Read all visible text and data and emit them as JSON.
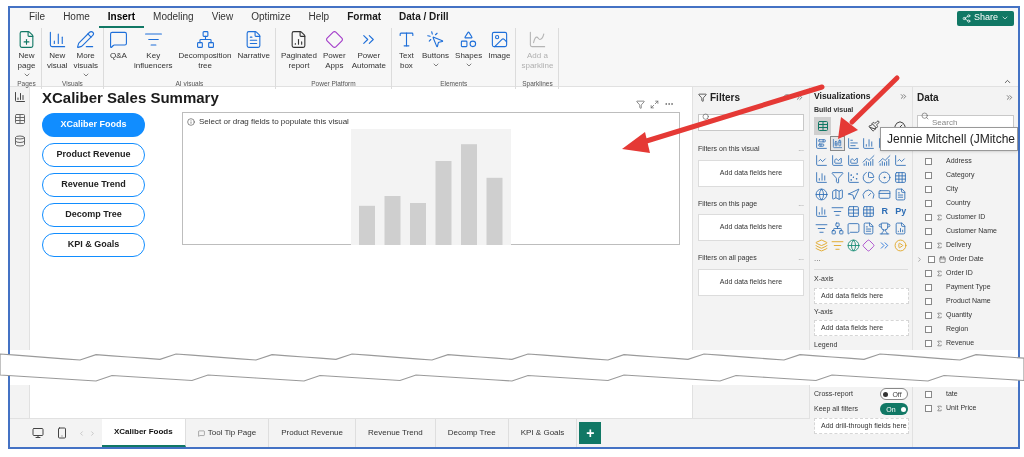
{
  "ribbon": {
    "tabs": [
      {
        "label": "File",
        "selected": false,
        "contextual": false
      },
      {
        "label": "Home",
        "selected": false,
        "contextual": false
      },
      {
        "label": "Insert",
        "selected": true,
        "contextual": false
      },
      {
        "label": "Modeling",
        "selected": false,
        "contextual": false
      },
      {
        "label": "View",
        "selected": false,
        "contextual": false
      },
      {
        "label": "Optimize",
        "selected": false,
        "contextual": false
      },
      {
        "label": "Help",
        "selected": false,
        "contextual": false
      },
      {
        "label": "Format",
        "selected": false,
        "contextual": true
      },
      {
        "label": "Data / Drill",
        "selected": false,
        "contextual": true
      }
    ],
    "share": "Share",
    "groups": [
      {
        "label": "Pages",
        "buttons": [
          {
            "label": "New\npage",
            "dropdown": true,
            "disabled": false
          }
        ]
      },
      {
        "label": "Visuals",
        "buttons": [
          {
            "label": "New\nvisual",
            "dropdown": false,
            "disabled": false
          },
          {
            "label": "More\nvisuals",
            "dropdown": true,
            "disabled": false
          }
        ]
      },
      {
        "label": "AI visuals",
        "buttons": [
          {
            "label": "Q&A",
            "dropdown": false,
            "disabled": false
          },
          {
            "label": "Key\ninfluencers",
            "dropdown": false,
            "disabled": false
          },
          {
            "label": "Decomposition\ntree",
            "dropdown": false,
            "disabled": false
          },
          {
            "label": "Narrative",
            "dropdown": false,
            "disabled": false
          }
        ]
      },
      {
        "label": "Power Platform",
        "buttons": [
          {
            "label": "Paginated\nreport",
            "dropdown": false,
            "disabled": false
          },
          {
            "label": "Power\nApps",
            "dropdown": false,
            "disabled": false
          },
          {
            "label": "Power\nAutomate",
            "dropdown": false,
            "disabled": false
          }
        ]
      },
      {
        "label": "Elements",
        "buttons": [
          {
            "label": "Text\nbox",
            "dropdown": false,
            "disabled": false
          },
          {
            "label": "Buttons",
            "dropdown": true,
            "disabled": false
          },
          {
            "label": "Shapes",
            "dropdown": true,
            "disabled": false
          },
          {
            "label": "Image",
            "dropdown": false,
            "disabled": false
          }
        ]
      },
      {
        "label": "Sparklines",
        "buttons": [
          {
            "label": "Add a\nsparkline",
            "dropdown": false,
            "disabled": true
          }
        ]
      }
    ]
  },
  "canvas": {
    "title": "XCaliber Sales Summary",
    "nav_buttons": [
      {
        "label": "XCaliber Foods",
        "selected": true
      },
      {
        "label": "Product Revenue",
        "selected": false
      },
      {
        "label": "Revenue Trend",
        "selected": false
      },
      {
        "label": "Decomp Tree",
        "selected": false
      },
      {
        "label": "KPI & Goals",
        "selected": false
      }
    ],
    "visual": {
      "hint": "Select or drag fields to populate this visual"
    }
  },
  "filters": {
    "title": "Filters",
    "sections": [
      {
        "title": "Filters on this visual",
        "more": "...",
        "drop": "Add data fields here"
      },
      {
        "title": "Filters on this page",
        "more": "...",
        "drop": "Add data fields here"
      },
      {
        "title": "Filters on all pages",
        "more": "...",
        "drop": "Add data fields here"
      }
    ]
  },
  "visualizations": {
    "title": "Visualizations",
    "subtitle": "Build visual",
    "build_tabs": [
      {
        "selected": true
      },
      {
        "selected": false
      },
      {
        "selected": false
      }
    ],
    "script_labels": [
      "R",
      "Py"
    ],
    "more": "...",
    "wells": [
      {
        "label": "X-axis",
        "drop": "Add data fields here"
      },
      {
        "label": "Y-axis",
        "drop": "Add data fields here"
      }
    ],
    "legend": "Legend",
    "toggles": [
      {
        "label": "Cross-report",
        "on": false,
        "text": "Off"
      },
      {
        "label": "Keep all filters",
        "on": true,
        "text": "On"
      }
    ],
    "drillthrough": "Add drill-through fields here"
  },
  "data": {
    "title": "Data",
    "search": {
      "placeholder": "Search"
    },
    "fields_top": [
      {
        "name": "Address",
        "kind": "plain",
        "checked": false
      },
      {
        "name": "Category",
        "kind": "plain",
        "checked": false
      },
      {
        "name": "City",
        "kind": "plain",
        "checked": false
      },
      {
        "name": "Country",
        "kind": "plain",
        "checked": false
      },
      {
        "name": "Customer ID",
        "kind": "sum",
        "checked": false
      },
      {
        "name": "Customer Name",
        "kind": "plain",
        "checked": false
      },
      {
        "name": "Delivery",
        "kind": "sum",
        "checked": false
      },
      {
        "name": "Order Date",
        "kind": "date",
        "checked": false
      },
      {
        "name": "Order ID",
        "kind": "sum",
        "checked": false
      },
      {
        "name": "Payment Type",
        "kind": "plain",
        "checked": false
      },
      {
        "name": "Product Name",
        "kind": "plain",
        "checked": false
      },
      {
        "name": "Quantity",
        "kind": "sum",
        "checked": false
      },
      {
        "name": "Region",
        "kind": "plain",
        "checked": false
      },
      {
        "name": "Revenue",
        "kind": "sum",
        "checked": false
      }
    ],
    "fields_bottom": [
      {
        "name": "tate",
        "kind": "plain",
        "checked": false
      },
      {
        "name": "Unit Price",
        "kind": "sum",
        "checked": false
      }
    ]
  },
  "tooltip": "Jennie Mitchell (JMitche",
  "page_tabs": [
    {
      "label": "XCaliber Foods",
      "selected": true,
      "kind": "page"
    },
    {
      "label": "Tool Tip Page",
      "selected": false,
      "kind": "tooltip"
    },
    {
      "label": "Product Revenue",
      "selected": false,
      "kind": "page"
    },
    {
      "label": "Revenue Trend",
      "selected": false,
      "kind": "page"
    },
    {
      "label": "Decomp Tree",
      "selected": false,
      "kind": "page"
    },
    {
      "label": "KPI & Goals",
      "selected": false,
      "kind": "page"
    }
  ],
  "add_page": "+"
}
